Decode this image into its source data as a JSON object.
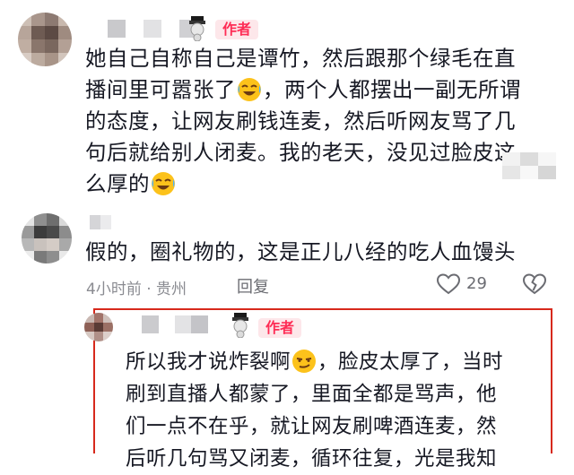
{
  "author_badge": "作者",
  "comment1": {
    "lines": [
      {
        "pre": "她自己自称自己是谭竹，然后跟那个绿毛在直",
        "emoji": "",
        "post": ""
      },
      {
        "pre": "播间里可嚣张了",
        "emoji": "laugh-cry",
        "post": "，两个人都摆出一副无所谓"
      },
      {
        "pre": "的态度，让网友刷钱连麦，然后听网友骂了几",
        "emoji": "",
        "post": ""
      },
      {
        "pre": "句后就给别人闭麦。我的老天，没见过脸皮这",
        "emoji": "",
        "post": ""
      },
      {
        "pre": "么厚的",
        "emoji": "laugh-cry",
        "post": ""
      }
    ]
  },
  "comment2": {
    "text": "假的，圈礼物的，这是正儿八经的吃人血馒头",
    "meta": "4小时前 · 贵州",
    "reply_label": "回复",
    "like_count": "29"
  },
  "reply": {
    "lines": [
      {
        "pre": "所以我才说炸裂啊",
        "emoji": "smirk",
        "post": "，脸皮太厚了，当时"
      },
      {
        "pre": "刷到直播人都蒙了，里面全都是骂声，他",
        "emoji": "",
        "post": ""
      },
      {
        "pre": "们一点不在乎，就让网友刷啤酒连麦，然",
        "emoji": "",
        "post": ""
      },
      {
        "pre": "后听几句骂又闭麦，循环往复，光是我知",
        "emoji": "",
        "post": ""
      }
    ]
  },
  "colors": {
    "badge_text": "#fe2c55",
    "badge_bg": "#fde7ea",
    "frame": "#d7291c",
    "meta": "#8a8b91"
  }
}
